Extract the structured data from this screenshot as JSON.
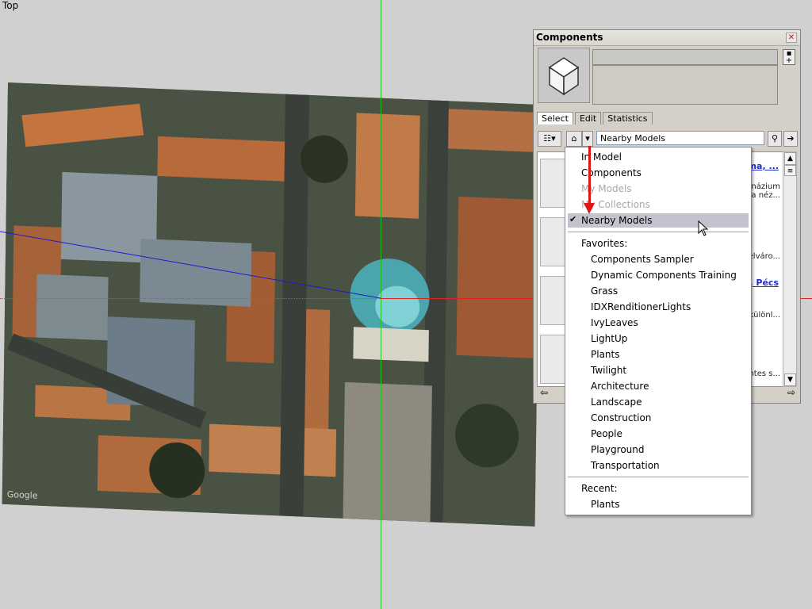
{
  "viewport": {
    "view_name": "Top",
    "google_logo": "Google"
  },
  "panel": {
    "title": "Components",
    "tabs": [
      "Select",
      "Edit",
      "Statistics"
    ],
    "search_value": "Nearby Models",
    "results": [
      {
        "link": "ma, ...",
        "desc": "mnázium\nra néz..."
      },
      {
        "link": "",
        "desc": "elváro..."
      },
      {
        "link": "n, Pécs",
        "desc": "különl..."
      },
      {
        "link": "",
        "desc": "ntes s..."
      }
    ]
  },
  "menu": {
    "items_top": [
      {
        "label": "In Model",
        "disabled": false
      },
      {
        "label": "Components",
        "disabled": false
      },
      {
        "label": "My Models",
        "disabled": true
      },
      {
        "label": "My Collections",
        "disabled": true
      },
      {
        "label": "Nearby Models",
        "disabled": false,
        "checked": true
      }
    ],
    "favorites_header": "Favorites:",
    "favorites": [
      "Components Sampler",
      "Dynamic Components Training",
      "Grass",
      "IDXRenditionerLights",
      "IvyLeaves",
      "LightUp",
      "Plants",
      "Twilight",
      "Architecture",
      "Landscape",
      "Construction",
      "People",
      "Playground",
      "Transportation"
    ],
    "recent_header": "Recent:",
    "recent": [
      "Plants"
    ]
  },
  "colors": {
    "axis_red": "#e02020",
    "axis_green": "#1fbf1f",
    "axis_blue": "#1a1ad0",
    "highlight": "#c3c3cf",
    "annotation_arrow": "#e01515",
    "link": "#1f2bd6"
  }
}
